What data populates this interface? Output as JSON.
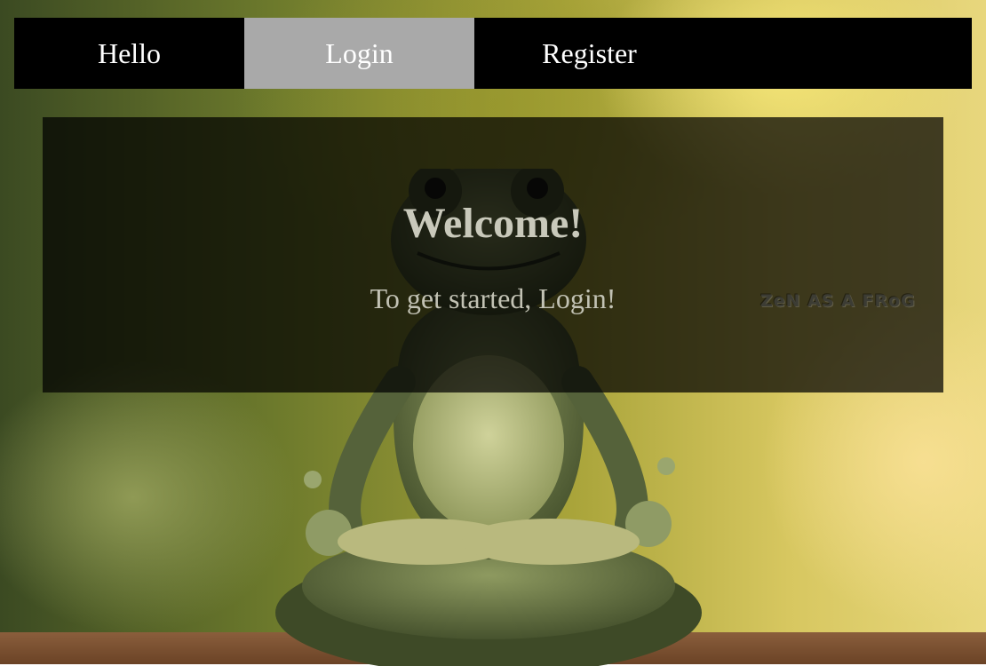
{
  "nav": {
    "items": [
      {
        "label": "Hello",
        "active": false
      },
      {
        "label": "Login",
        "active": true
      },
      {
        "label": "Register",
        "active": false
      }
    ],
    "active_color": "#a9a9a9",
    "bar_color": "#000000"
  },
  "welcome": {
    "title": "Welcome!",
    "subtitle": "To get started, Login!"
  },
  "background": {
    "stamp_text": "ZeN AS A FRoG"
  }
}
